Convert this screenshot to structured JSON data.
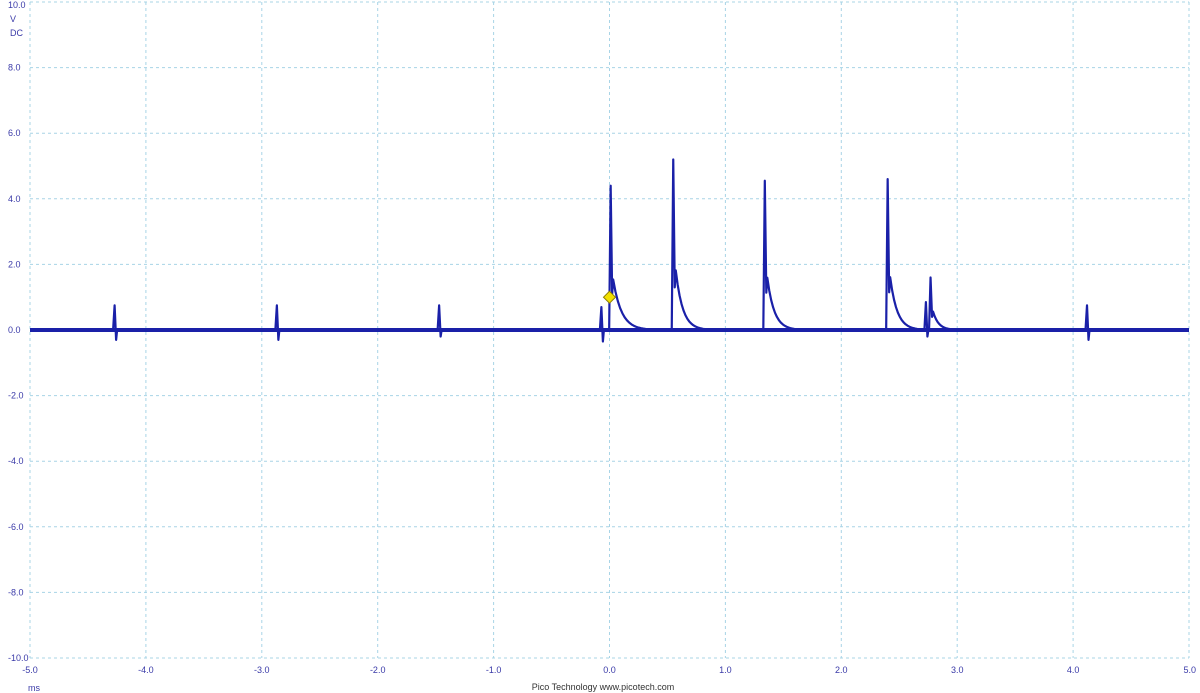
{
  "chart_data": {
    "type": "line",
    "title": "",
    "xlabel": "ms",
    "ylabel": "V",
    "coupling": "DC",
    "xlim": [
      -5.0,
      5.0
    ],
    "ylim": [
      -10.0,
      10.0
    ],
    "x_ticks": [
      "-5.0",
      "-4.0",
      "-3.0",
      "-2.0",
      "-1.0",
      "0.0",
      "1.0",
      "2.0",
      "3.0",
      "4.0",
      "5.0"
    ],
    "y_ticks": [
      "10.0",
      "8.0",
      "6.0",
      "4.0",
      "2.0",
      "0.0",
      "-2.0",
      "-4.0",
      "-6.0",
      "-8.0",
      "-10.0"
    ],
    "grid": true,
    "grid_style": "dashed",
    "trigger_marker": {
      "x": 0.0,
      "y": 1.0,
      "color": "#f2e000"
    },
    "series": [
      {
        "color": "#1a20a8",
        "baseline": 0.0,
        "spikes": [
          {
            "x": -4.27,
            "high": 0.75,
            "low": -0.3
          },
          {
            "x": -2.87,
            "high": 0.75,
            "low": -0.3
          },
          {
            "x": -1.47,
            "high": 0.75,
            "low": -0.2
          },
          {
            "x": -0.07,
            "high": 0.7,
            "low": -0.35
          },
          {
            "x": 0.01,
            "high": 4.4,
            "low": 0.0,
            "decay": 0.12
          },
          {
            "x": 0.55,
            "high": 5.2,
            "low": 0.0,
            "decay": 0.1
          },
          {
            "x": 1.34,
            "high": 4.55,
            "low": 0.0,
            "decay": 0.1
          },
          {
            "x": 2.4,
            "high": 4.6,
            "low": 0.0,
            "decay": 0.1
          },
          {
            "x": 2.73,
            "high": 0.85,
            "low": -0.2
          },
          {
            "x": 2.77,
            "high": 1.6,
            "low": 0.0,
            "decay": 0.08
          },
          {
            "x": 4.12,
            "high": 0.75,
            "low": -0.3
          }
        ]
      }
    ]
  },
  "footer": {
    "x_unit": "ms",
    "brand": "Pico Technology  www.picotech.com"
  },
  "colors": {
    "trace": "#1a20a8",
    "grid": "#a8d4e6",
    "axis_text": "#3a3aa8",
    "trigger": "#f2e000"
  }
}
